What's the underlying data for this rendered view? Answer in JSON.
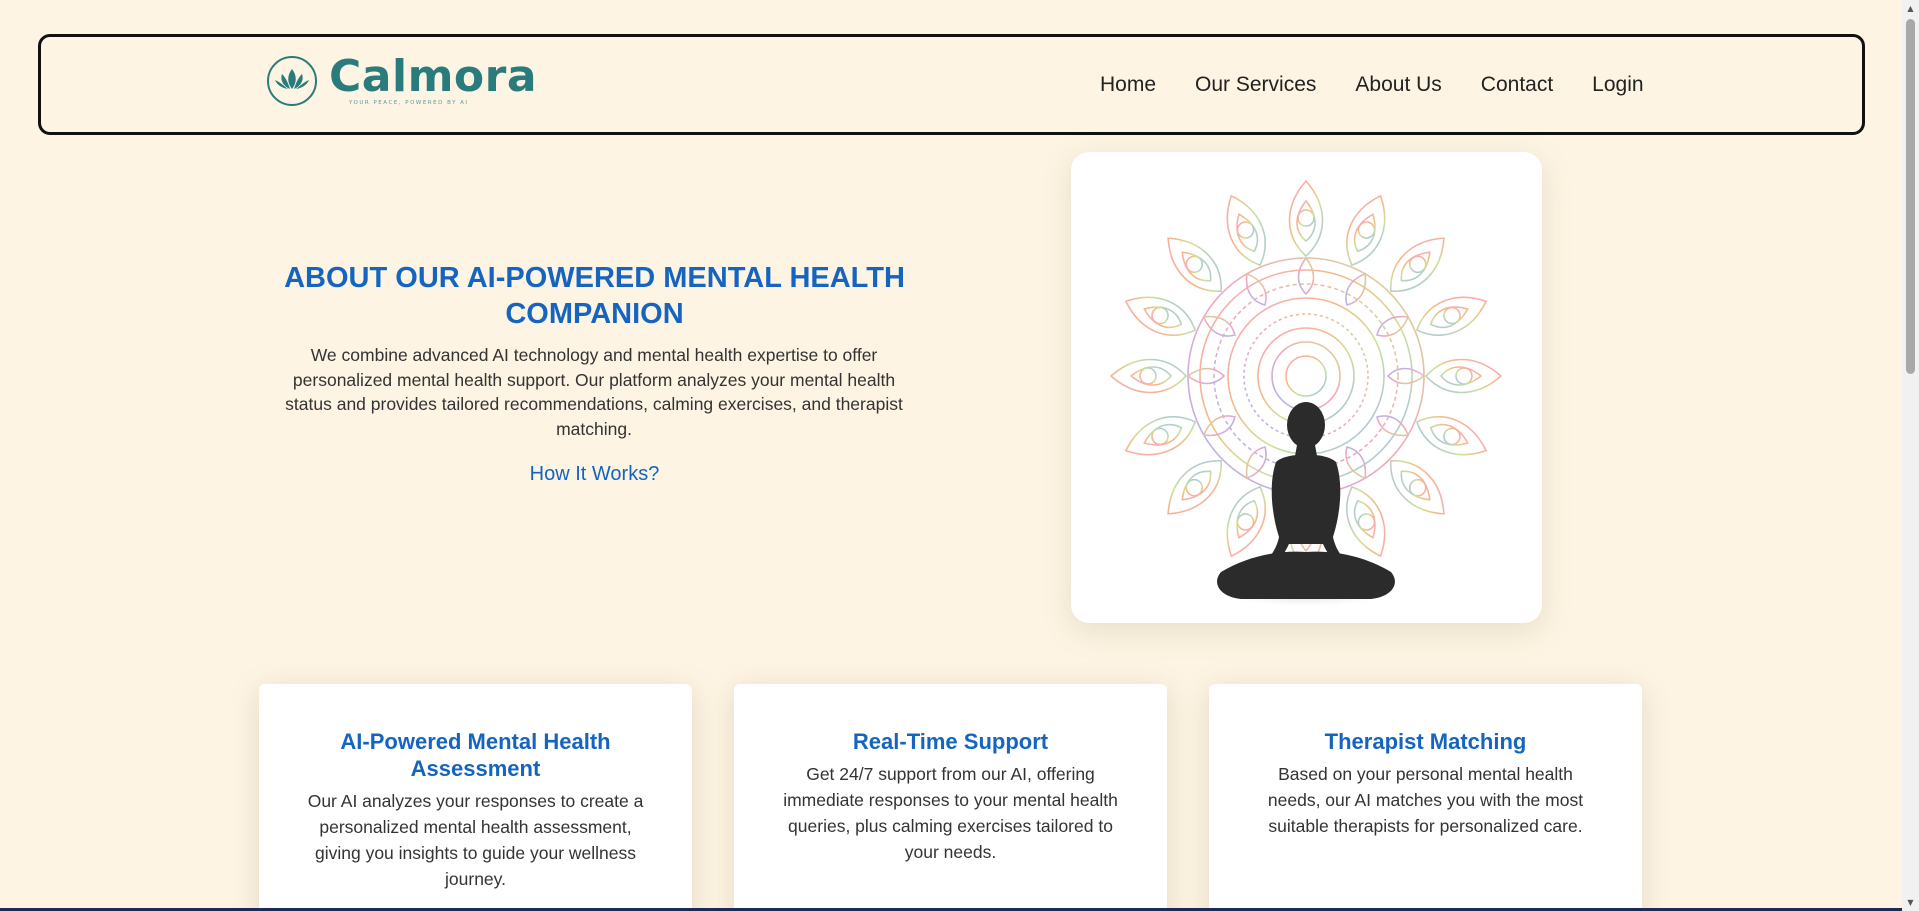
{
  "brand": {
    "name": "Calmora",
    "tagline": "YOUR PEACE, POWERED BY AI",
    "color": "#2a7c7c"
  },
  "nav": {
    "links": [
      {
        "label": "Home"
      },
      {
        "label": "Our Services"
      },
      {
        "label": "About Us"
      },
      {
        "label": "Contact"
      },
      {
        "label": "Login"
      }
    ]
  },
  "hero": {
    "title": "ABOUT OUR AI-POWERED MENTAL HEALTH COMPANION",
    "description": "We combine advanced AI technology and mental health expertise to offer personalized mental health support. Our platform analyzes your mental health status and provides tailored recommendations, calming exercises, and therapist matching.",
    "link": "How It Works?",
    "image_icon": "meditation-mandala-icon"
  },
  "cards": [
    {
      "title": "AI-Powered Mental Health Assessment",
      "description": "Our AI analyzes your responses to create a personalized mental health assessment, giving you insights to guide your wellness journey."
    },
    {
      "title": "Real-Time Support",
      "description": "Get 24/7 support from our AI, offering immediate responses to your mental health queries, plus calming exercises tailored to your needs."
    },
    {
      "title": "Therapist Matching",
      "description": "Based on your personal mental health needs, our AI matches you with the most suitable therapists for personalized care."
    }
  ],
  "colors": {
    "accent": "#1565c0",
    "background": "#fdf4e3",
    "text": "#333333"
  }
}
